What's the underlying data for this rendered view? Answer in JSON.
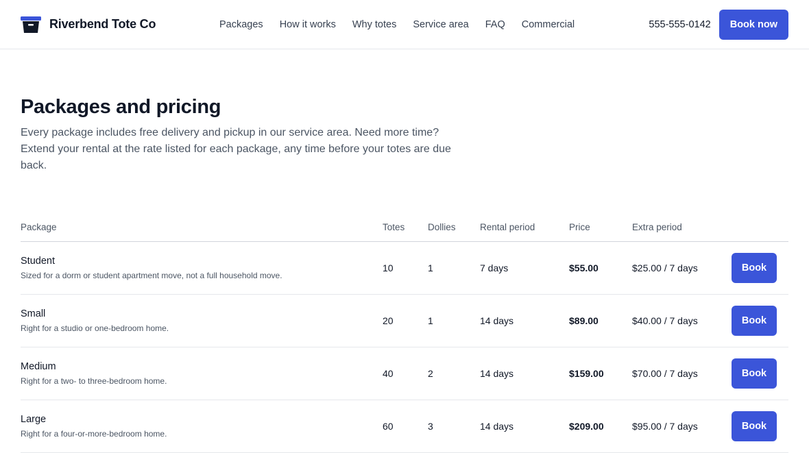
{
  "header": {
    "brand_name": "Riverbend Tote Co",
    "logo_icon": "tote-box-icon",
    "nav": [
      {
        "label": "Packages"
      },
      {
        "label": "How it works"
      },
      {
        "label": "Why totes"
      },
      {
        "label": "Service area"
      },
      {
        "label": "FAQ"
      },
      {
        "label": "Commercial"
      }
    ],
    "phone": "555-555-0142",
    "book_now_label": "Book now"
  },
  "main": {
    "title": "Packages and pricing",
    "intro": "Every package includes free delivery and pickup in our service area. Need more time? Extend your rental at the rate listed for each package, any time before your totes are due back."
  },
  "table": {
    "headers": {
      "package": "Package",
      "totes": "Totes",
      "dollies": "Dollies",
      "rental_period": "Rental period",
      "price": "Price",
      "extra_period": "Extra period"
    },
    "rows": [
      {
        "name": "Student",
        "description": "Sized for a dorm or student apartment move, not a full household move.",
        "totes": "10",
        "dollies": "1",
        "rental_period": "7 days",
        "price": "$55.00",
        "extra_period": "$25.00 / 7 days",
        "book_label": "Book"
      },
      {
        "name": "Small",
        "description": "Right for a studio or one-bedroom home.",
        "totes": "20",
        "dollies": "1",
        "rental_period": "14 days",
        "price": "$89.00",
        "extra_period": "$40.00 / 7 days",
        "book_label": "Book"
      },
      {
        "name": "Medium",
        "description": "Right for a two- to three-bedroom home.",
        "totes": "40",
        "dollies": "2",
        "rental_period": "14 days",
        "price": "$159.00",
        "extra_period": "$70.00 / 7 days",
        "book_label": "Book"
      },
      {
        "name": "Large",
        "description": "Right for a four-or-more-bedroom home.",
        "totes": "60",
        "dollies": "3",
        "rental_period": "14 days",
        "price": "$209.00",
        "extra_period": "$95.00 / 7 days",
        "book_label": "Book"
      }
    ]
  },
  "colors": {
    "accent": "#3b55d9",
    "logo_body": "#111827"
  }
}
